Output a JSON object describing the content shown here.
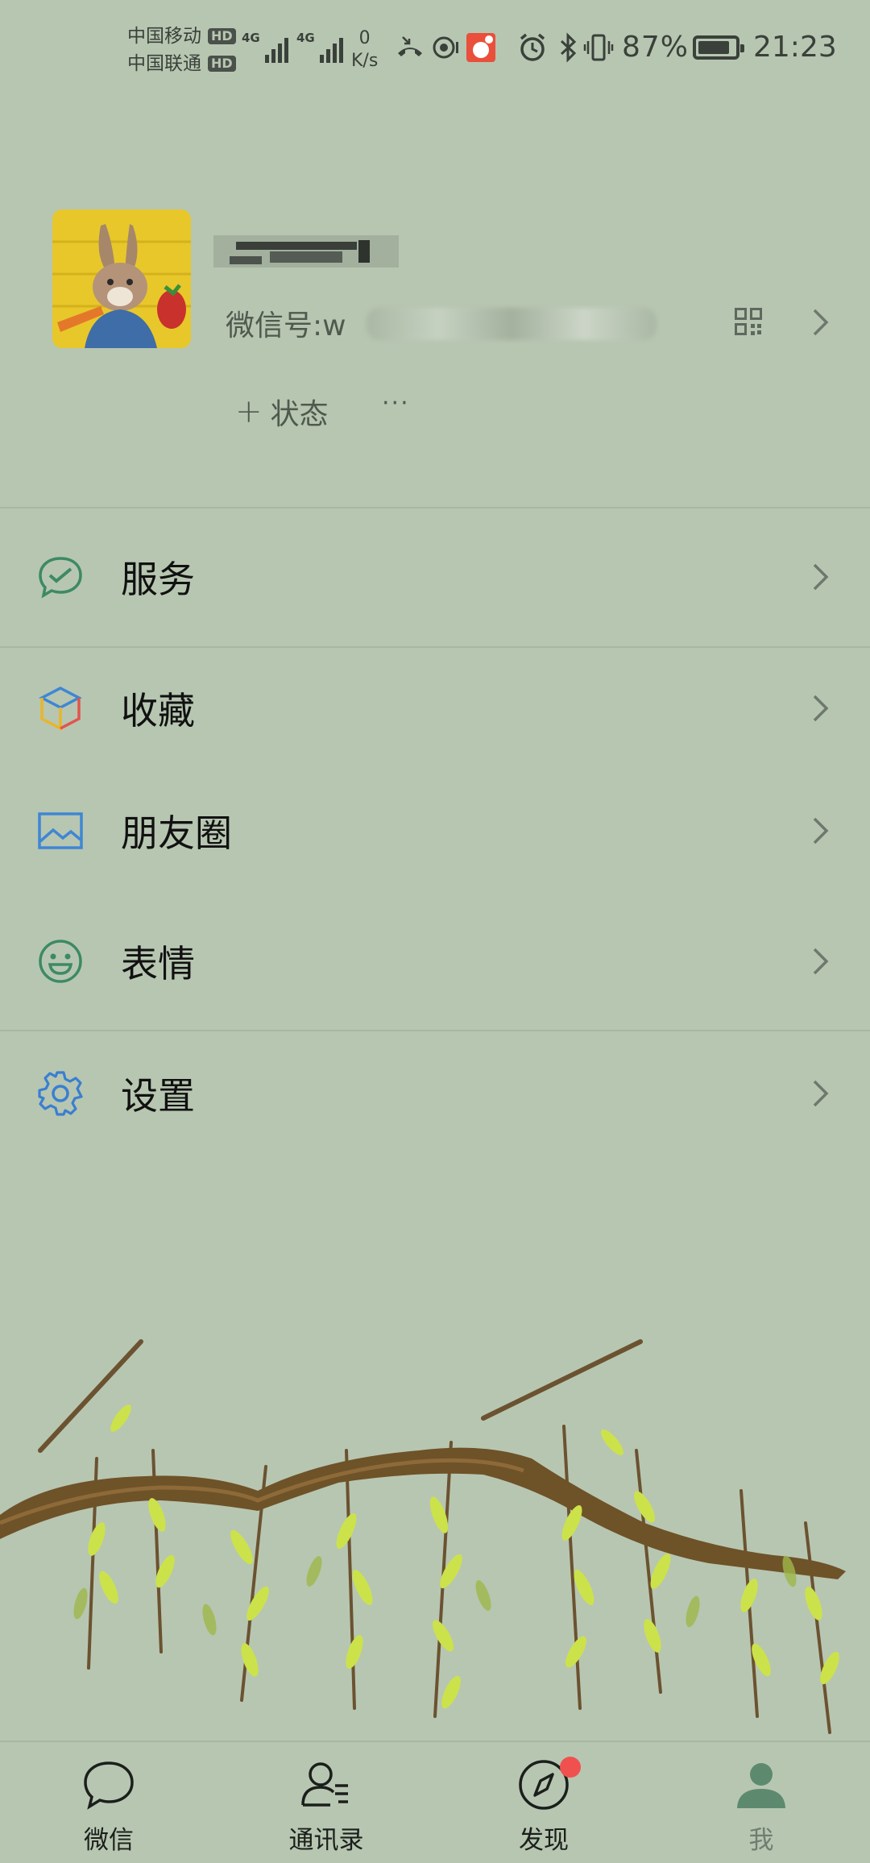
{
  "status_bar": {
    "carrier1": "中国移动",
    "carrier2": "中国联通",
    "hd": "HD",
    "net1": "4G",
    "net2": "4G",
    "speed_value": "0",
    "speed_unit": "K/s",
    "battery": "87%",
    "battery_level": 0.87,
    "time": "21:23"
  },
  "profile": {
    "wechat_id_prefix": "微信号:w",
    "status_label": "状态",
    "more_label": "···"
  },
  "menu": [
    {
      "label": "服务",
      "icon": "service-icon"
    },
    {
      "label": "收藏",
      "icon": "favorites-icon"
    },
    {
      "label": "朋友圈",
      "icon": "moments-icon"
    },
    {
      "label": "表情",
      "icon": "sticker-icon"
    },
    {
      "label": "设置",
      "icon": "settings-icon"
    }
  ],
  "tabs": [
    {
      "label": "微信",
      "icon": "chat-icon"
    },
    {
      "label": "通讯录",
      "icon": "contacts-icon"
    },
    {
      "label": "发现",
      "icon": "discover-icon"
    },
    {
      "label": "我",
      "icon": "me-icon",
      "active": true
    }
  ],
  "colors": {
    "background": "#b7c6b1",
    "active_tab": "#5d8a6e",
    "badge": "#f0514f",
    "settings_icon": "#3a7fd0"
  }
}
